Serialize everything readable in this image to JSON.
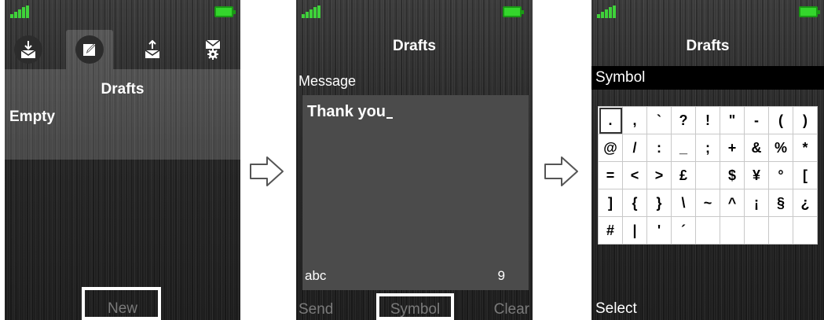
{
  "colors": {
    "signal": "#3fd23a",
    "battery": "#34d62c",
    "softkey_dim": "#7a7a7a",
    "highlight": "#ffffff"
  },
  "screen1": {
    "tabs": [
      {
        "icon": "inbox-download-icon"
      },
      {
        "icon": "compose-edit-icon",
        "active": true
      },
      {
        "icon": "outbox-upload-icon"
      },
      {
        "icon": "message-settings-icon"
      }
    ],
    "title": "Drafts",
    "list_item": "Empty",
    "softkey_center": "New"
  },
  "screen2": {
    "title": "Drafts",
    "field_label": "Message",
    "message_text": "Thank you",
    "input_mode": "abc",
    "char_count": "9",
    "softkey_left": "Send",
    "softkey_center": "Symbol",
    "softkey_right": "Clear"
  },
  "screen3": {
    "title": "Drafts",
    "header": "Symbol",
    "symbols": [
      [
        ".",
        ",",
        "`",
        "?",
        "!",
        "\"",
        "-",
        "(",
        ")"
      ],
      [
        "@",
        "/",
        ":",
        "_",
        ";",
        "+",
        "&",
        "%",
        "*"
      ],
      [
        "=",
        "<",
        ">",
        "£",
        "",
        "$",
        "¥",
        "°",
        "["
      ],
      [
        "]",
        "{",
        "}",
        "\\",
        "~",
        "^",
        "¡",
        "§",
        "¿"
      ],
      [
        "#",
        "|",
        "'",
        "´",
        "",
        "",
        "",
        "",
        ""
      ]
    ],
    "softkey_left": "Select"
  }
}
